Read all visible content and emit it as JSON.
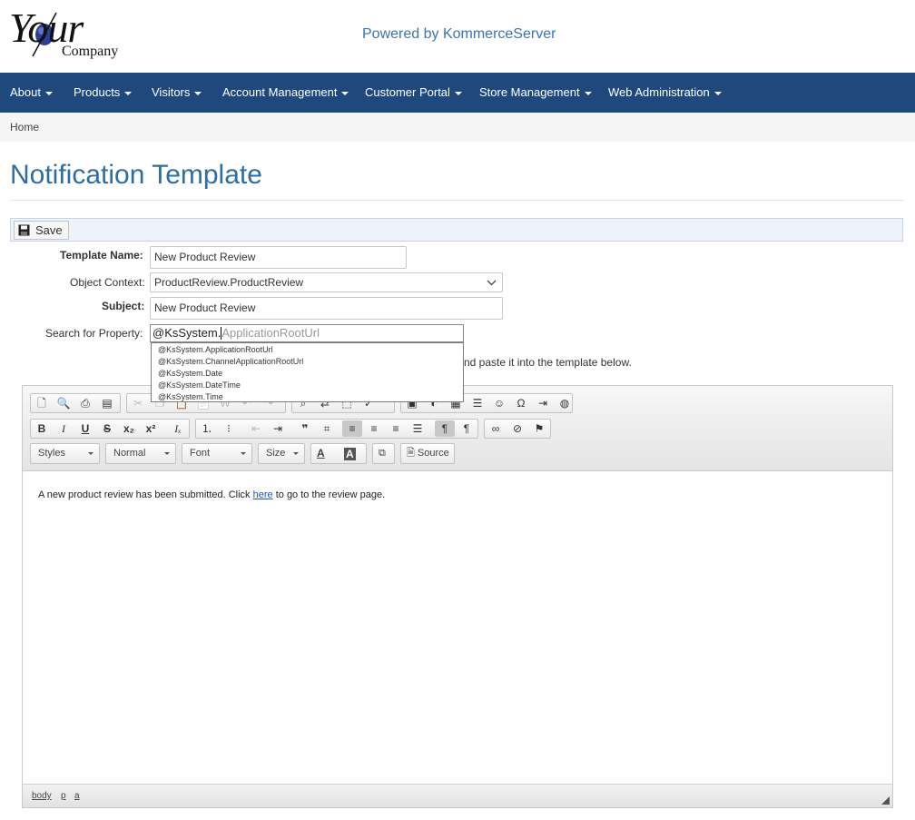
{
  "brand": {
    "logo_word": "Your",
    "logo_sub": "Company",
    "powered_by": "Powered by KommerceServer"
  },
  "nav": [
    {
      "label": "About"
    },
    {
      "label": "Products"
    },
    {
      "label": "Visitors"
    },
    {
      "label": "Account Management"
    },
    {
      "label": "Customer Portal"
    },
    {
      "label": "Store Management"
    },
    {
      "label": "Web Administration"
    }
  ],
  "breadcrumb": {
    "home": "Home"
  },
  "page": {
    "title": "Notification Template"
  },
  "toolbar": {
    "save_label": "Save"
  },
  "form": {
    "template_name_label": "Template Name:",
    "template_name_value": "New Product Review",
    "object_context_label": "Object Context:",
    "object_context_value": "ProductReview.ProductReview",
    "subject_label": "Subject:",
    "subject_value": "New Product Review",
    "search_label": "Search for Property:",
    "search_typed": "@KsSystem.",
    "search_completion": "ApplicationRootUrl",
    "instructions_visible": "nd paste it into the template below."
  },
  "suggestions": [
    "@KsSystem.ApplicationRootUrl",
    "@KsSystem.ChannelApplicationRootUrl",
    "@KsSystem.Date",
    "@KsSystem.DateTime",
    "@KsSystem.Time"
  ],
  "editor": {
    "combos": {
      "styles": "Styles",
      "format": "Normal",
      "font": "Font",
      "size": "Size",
      "source": "Source"
    },
    "content_before": "A new product review has been submitted. Click ",
    "content_link": "here",
    "content_after": " to go to the review page.",
    "path": [
      "body",
      "p",
      "a"
    ]
  },
  "colors": {
    "navbar": "#1f497d",
    "title": "#2e6da4",
    "powered": "#3a73b4"
  }
}
